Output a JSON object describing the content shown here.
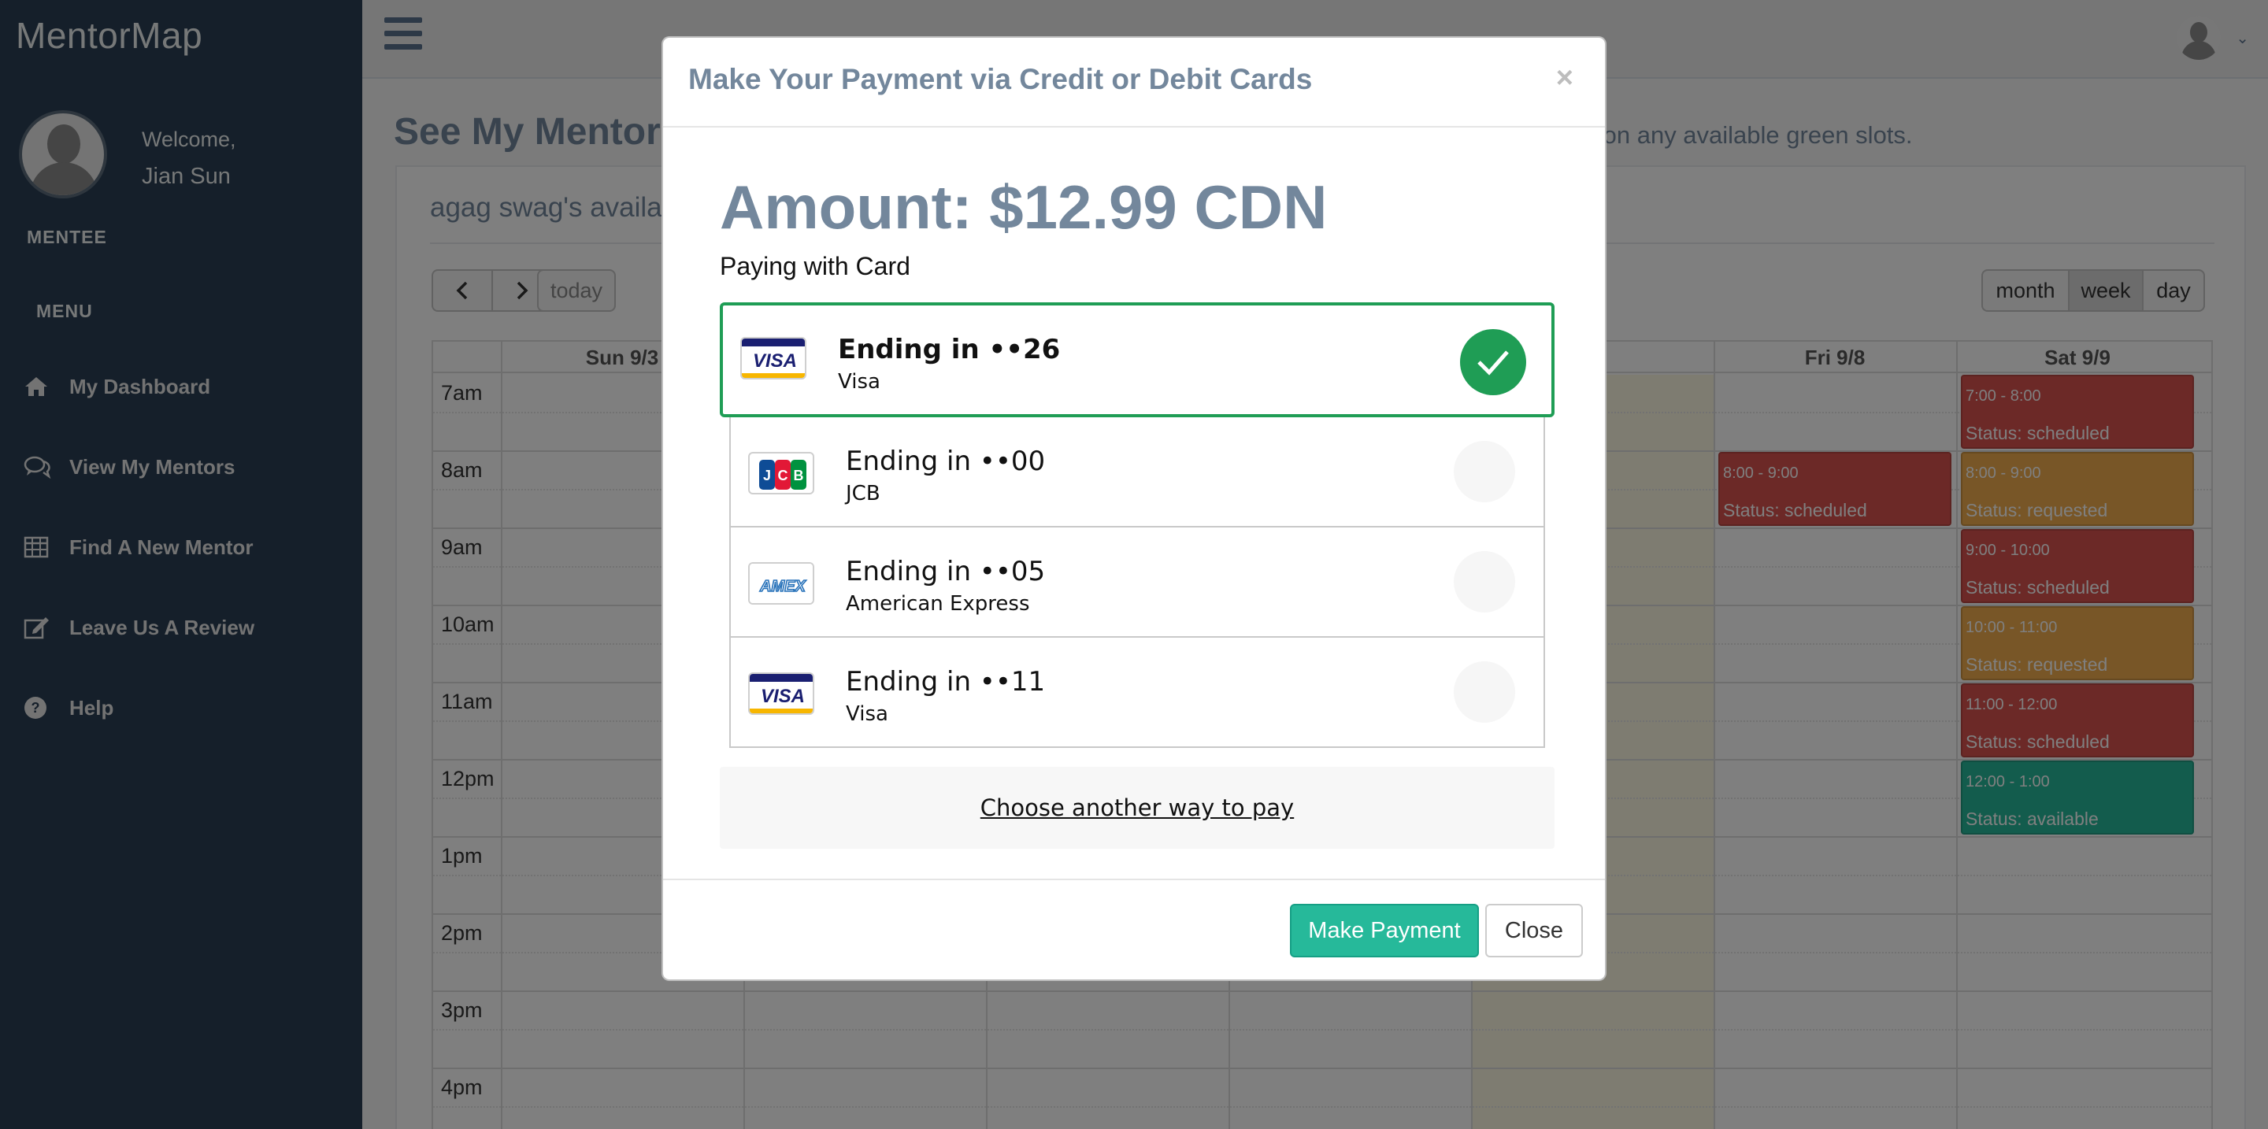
{
  "app": {
    "brand": "MentorMap"
  },
  "sidebar": {
    "welcome": "Welcome,",
    "user_name": "Jian Sun",
    "role": "MENTEE",
    "menu_title": "MENU",
    "items": [
      {
        "label": "My Dashboard",
        "icon": "home-icon"
      },
      {
        "label": "View My Mentors",
        "icon": "comments-icon"
      },
      {
        "label": "Find A New Mentor",
        "icon": "table-icon"
      },
      {
        "label": "Leave Us A Review",
        "icon": "edit-icon"
      },
      {
        "label": "Help",
        "icon": "question-circle-icon"
      }
    ]
  },
  "main": {
    "page_title": "See My Mentor",
    "instruction_tail": "ck on any available green slots.",
    "panel_title": "agag swag's availa",
    "toolbar": {
      "prev": "‹",
      "next": "›",
      "today": "today",
      "views": [
        "month",
        "week",
        "day"
      ],
      "active_view": "week"
    }
  },
  "calendar": {
    "days": [
      {
        "label": "Sun 9/3"
      },
      {
        "label": ""
      },
      {
        "label": ""
      },
      {
        "label": ""
      },
      {
        "label": "/7"
      },
      {
        "label": "Fri 9/8"
      },
      {
        "label": "Sat 9/9"
      }
    ],
    "times": [
      "7am",
      "8am",
      "9am",
      "10am",
      "11am",
      "12pm",
      "1pm",
      "2pm",
      "3pm",
      "4pm"
    ],
    "events": [
      {
        "day": "Fri 9/8",
        "time": "8:00 - 9:00",
        "status": "Status: scheduled",
        "color": "#D9534F"
      },
      {
        "day": "Sat 9/9",
        "time": "7:00 - 8:00",
        "status": "Status: scheduled",
        "color": "#D9534F"
      },
      {
        "day": "Sat 9/9",
        "time": "8:00 - 9:00",
        "status": "Status: requested",
        "color": "#F0AD4E"
      },
      {
        "day": "Sat 9/9",
        "time": "9:00 - 10:00",
        "status": "Status: scheduled",
        "color": "#D9534F"
      },
      {
        "day": "Sat 9/9",
        "time": "10:00 - 11:00",
        "status": "Status: requested",
        "color": "#F0AD4E"
      },
      {
        "day": "Sat 9/9",
        "time": "11:00 - 12:00",
        "status": "Status: scheduled",
        "color": "#D9534F"
      },
      {
        "day": "Sat 9/9",
        "time": "12:00 - 1:00",
        "status": "Status: available",
        "color": "#26B99A"
      }
    ]
  },
  "modal": {
    "title": "Make Your Payment via Credit or Debit Cards",
    "close_x": "×",
    "amount": "Amount: $12.99 CDN",
    "paying_with": "Paying with Card",
    "cards": [
      {
        "title": "Ending in ••26",
        "brand": "Visa",
        "logo": "visa-logo",
        "selected": true
      },
      {
        "title": "Ending in ••00",
        "brand": "JCB",
        "logo": "jcb-logo",
        "selected": false
      },
      {
        "title": "Ending in ••05",
        "brand": "American Express",
        "logo": "amex-logo",
        "selected": false
      },
      {
        "title": "Ending in ••11",
        "brand": "Visa",
        "logo": "visa-logo",
        "selected": false
      }
    ],
    "other_way": "Choose another way to pay",
    "pay_button": "Make Payment",
    "close_button": "Close"
  },
  "colors": {
    "sidebar_bg": "#2A3F54",
    "accent_green": "#26B99A",
    "selected_card_border": "#1F9D55",
    "scheduled": "#D9534F",
    "requested": "#F0AD4E",
    "available": "#26B99A"
  }
}
